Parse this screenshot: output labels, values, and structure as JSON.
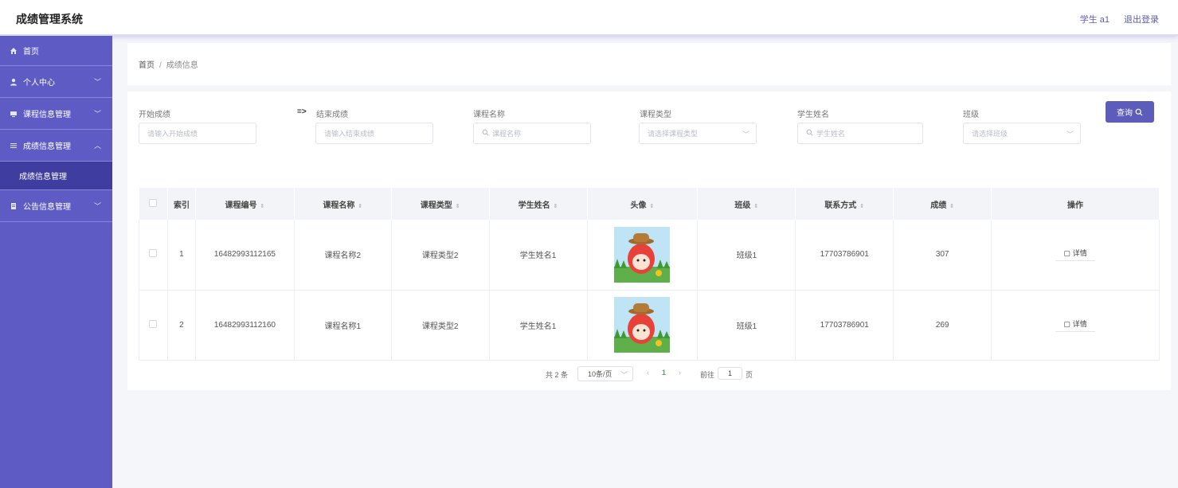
{
  "header": {
    "title": "成绩管理系统",
    "user": "学生 a1",
    "logout": "退出登录"
  },
  "sidebar": {
    "items": [
      {
        "label": "首页"
      },
      {
        "label": "个人中心"
      },
      {
        "label": "课程信息管理"
      },
      {
        "label": "成绩信息管理"
      },
      {
        "label": "公告信息管理"
      }
    ],
    "subitem": "成绩信息管理"
  },
  "breadcrumb": {
    "home": "首页",
    "separator": "/",
    "current": "成绩信息"
  },
  "filters": {
    "start_score": {
      "label": "开始成绩",
      "placeholder": "请输入开始成绩"
    },
    "arrow": "=>",
    "end_score": {
      "label": "结束成绩",
      "placeholder": "请输入结束成绩"
    },
    "course_name": {
      "label": "课程名称",
      "placeholder": "课程名称"
    },
    "course_type": {
      "label": "课程类型",
      "placeholder": "请选择课程类型"
    },
    "student_name": {
      "label": "学生姓名",
      "placeholder": "学生姓名"
    },
    "class": {
      "label": "班级",
      "placeholder": "请选择班级"
    },
    "search_button": "查询"
  },
  "table": {
    "columns": [
      "索引",
      "课程编号",
      "课程名称",
      "课程类型",
      "学生姓名",
      "头像",
      "班级",
      "联系方式",
      "成绩",
      "操作"
    ],
    "rows": [
      {
        "index": "1",
        "course_id": "16482993112165",
        "course_name": "课程名称2",
        "course_type": "课程类型2",
        "student_name": "学生姓名1",
        "class": "班级1",
        "contact": "17703786901",
        "score": "307",
        "action": "详情"
      },
      {
        "index": "2",
        "course_id": "16482993112160",
        "course_name": "课程名称1",
        "course_type": "课程类型2",
        "student_name": "学生姓名1",
        "class": "班级1",
        "contact": "17703786901",
        "score": "269",
        "action": "详情"
      }
    ]
  },
  "pagination": {
    "total": "共 2 条",
    "page_size": "10条/页",
    "current_page": "1",
    "goto_prefix": "前往",
    "goto_value": "1",
    "goto_suffix": "页"
  },
  "colors": {
    "accent": "#5c5cba",
    "sidebar": "#5e5cc4",
    "sidebar_active": "#3f3d9f"
  }
}
